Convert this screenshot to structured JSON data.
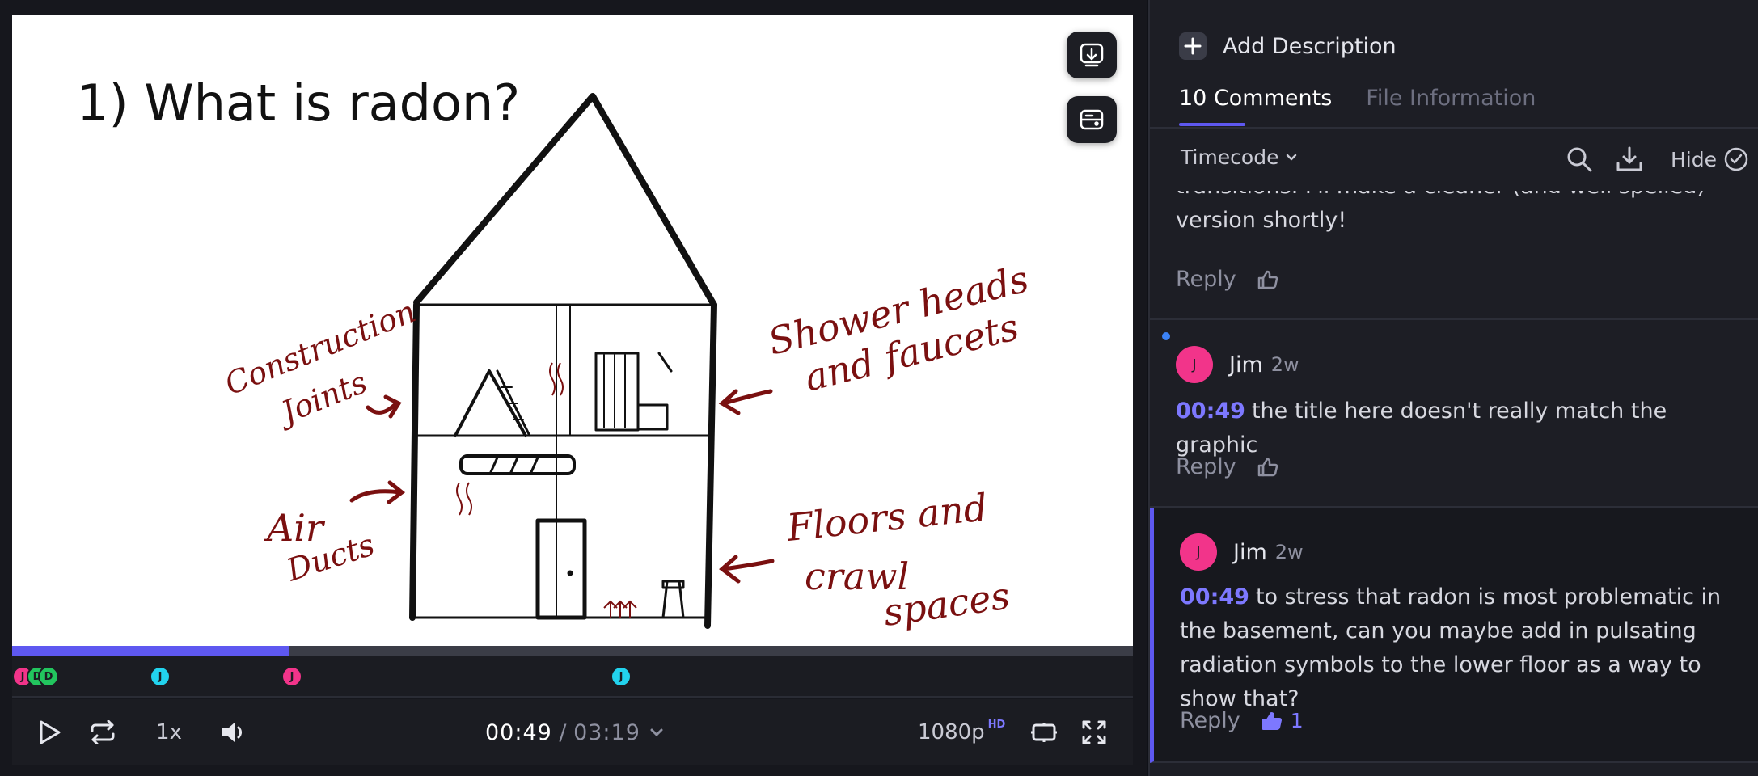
{
  "player": {
    "drawing": {
      "title": "1) What is radon?",
      "labels": {
        "construction": [
          "Construction",
          "Joints"
        ],
        "air": [
          "Air",
          "Ducts"
        ],
        "shower": [
          "Shower heads",
          "and faucets"
        ],
        "floors": [
          "Floors and",
          "crawl",
          "spaces"
        ]
      }
    },
    "progress_fraction": 0.247,
    "markers": [
      {
        "initial": "J",
        "color": "#f2348a"
      },
      {
        "initial": "D",
        "color": "#22c55e"
      },
      {
        "initial": "D",
        "color": "#22c55e"
      },
      {
        "initial": "J",
        "color": "#22d3ee"
      },
      {
        "initial": "J",
        "color": "#f2348a"
      },
      {
        "initial": "J",
        "color": "#22d3ee"
      }
    ],
    "controls": {
      "speed": "1x",
      "time_current": "00:49",
      "time_separator": " / ",
      "time_total": "03:19",
      "quality": "1080p",
      "quality_badge": "HD"
    }
  },
  "sidebar": {
    "add_description": "Add Description",
    "tabs": [
      {
        "label": "10 Comments",
        "active": true
      },
      {
        "label": "File Information",
        "active": false
      }
    ],
    "sort_label": "Timecode",
    "hide_label": "Hide",
    "comments": [
      {
        "partial": true,
        "text": "transitions. I'll make a cleaner (and well spelled) version shortly!",
        "reply_label": "Reply"
      },
      {
        "author": "Jim",
        "initial": "J",
        "age": "2w",
        "timecode": "00:49",
        "text": "the title here doesn't really match the graphic",
        "reply_label": "Reply",
        "unread": true
      },
      {
        "author": "Jim",
        "initial": "J",
        "age": "2w",
        "timecode": "00:49",
        "text": "to stress that radon is most problematic in the basement, can you maybe add in pulsating radiation symbols to the lower floor as a way to show that?",
        "reply_label": "Reply",
        "likes": "1",
        "active": true
      }
    ]
  },
  "colors": {
    "accent": "#5e58f0",
    "avatar_pink": "#f2348a",
    "drawing_red": "#7a1010"
  }
}
